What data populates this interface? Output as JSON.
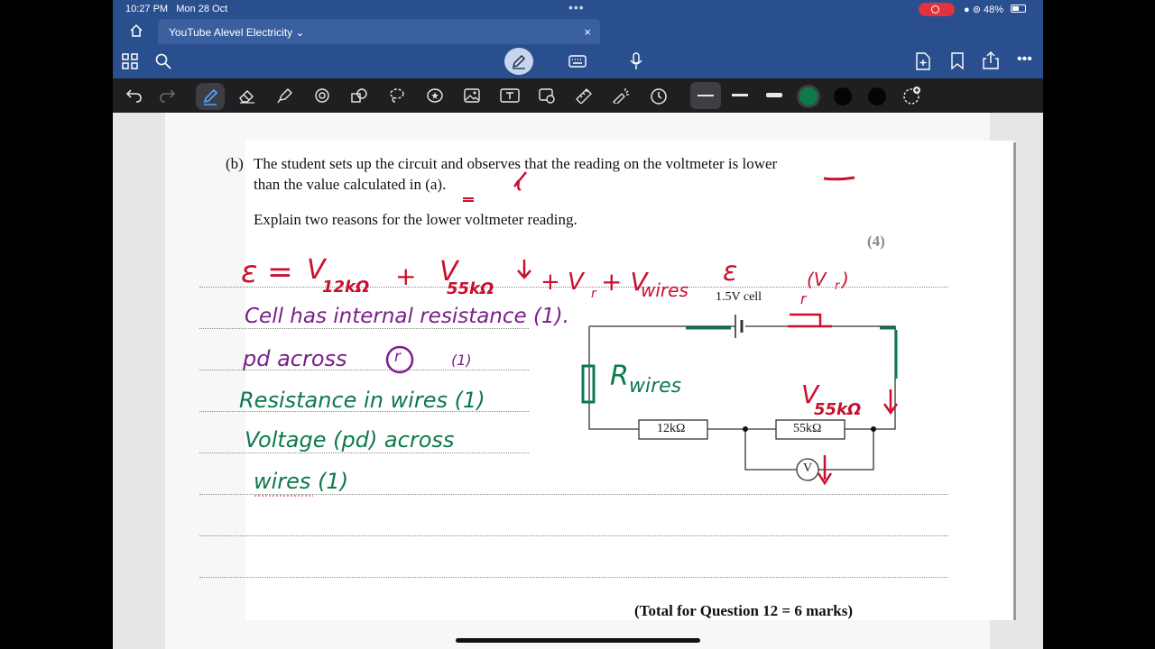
{
  "status": {
    "time": "10:27 PM",
    "date": "Mon 28 Oct",
    "battery": "48%"
  },
  "tab": {
    "title": "YouTube Alevel Electricity",
    "close": "×"
  },
  "question": {
    "label": "(b)",
    "line1": "The student sets up the circuit and observes that the reading on the voltmeter is lower",
    "line2": "than the value calculated in (a).",
    "instruction": "Explain two reasons for the lower voltmeter reading.",
    "marks": "(4)",
    "total": "(Total for Question 12 = 6 marks)"
  },
  "circuit": {
    "cell_label": "1.5V cell",
    "r1": "12kΩ",
    "r2": "55kΩ",
    "meter": "V"
  },
  "handwriting": {
    "eq_e": "ε =",
    "eq_v1": "V",
    "eq_v1_sub": "12kΩ",
    "eq_plus1": "+",
    "eq_v2": "V",
    "eq_v2_sub": "55kΩ",
    "eq_rest": "+ V",
    "eq_rest_sub": "r",
    "eq_plus2": "+ V",
    "eq_wires_sub": "wires",
    "line1": "Cell has internal resistance (1).",
    "line2a": "pd across",
    "line2b": "r",
    "line2c": "(1)",
    "line3": "Resistance in wires (1)",
    "line4": "Voltage (pd) across",
    "line5": "wires (1)",
    "epsilon": "ε",
    "vr": "(V",
    "vr_sub": "r",
    "vr_close": ")",
    "r_mark": "r",
    "rwires": "R",
    "rwires_sub": "wires",
    "v55": "V",
    "v55_sub": "55kΩ",
    "lower_mark": "="
  },
  "colors": {
    "red": "#c8102e",
    "purple": "#7a1f8a",
    "green": "#0d7a4a",
    "toolbar_blue": "#2a4f8f"
  }
}
